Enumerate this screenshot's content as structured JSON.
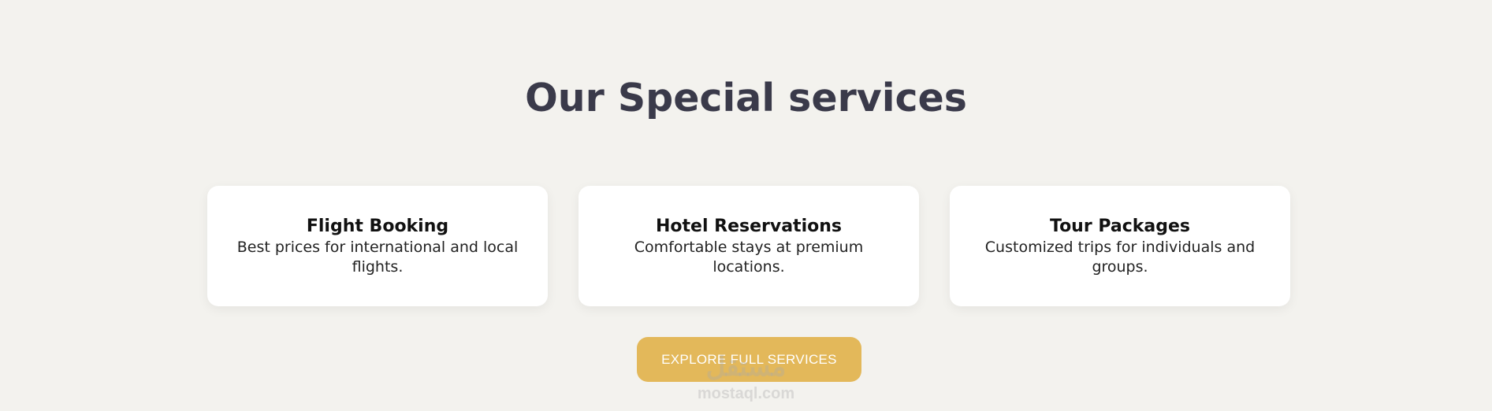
{
  "section": {
    "title": "Our Special services"
  },
  "services": [
    {
      "title": "Flight Booking",
      "description": "Best prices for international and local flights."
    },
    {
      "title": "Hotel Reservations",
      "description": "Comfortable stays at premium locations."
    },
    {
      "title": "Tour Packages",
      "description": "Customized trips for individuals and groups."
    }
  ],
  "cta": {
    "label": "EXPLORE FULL SERVICES"
  },
  "watermark": {
    "logo_text": "مستقل",
    "url": "mostaql.com"
  },
  "colors": {
    "background": "#f3f2ee",
    "card": "#ffffff",
    "accent": "#e3b85a",
    "heading": "#3a3a4a"
  }
}
